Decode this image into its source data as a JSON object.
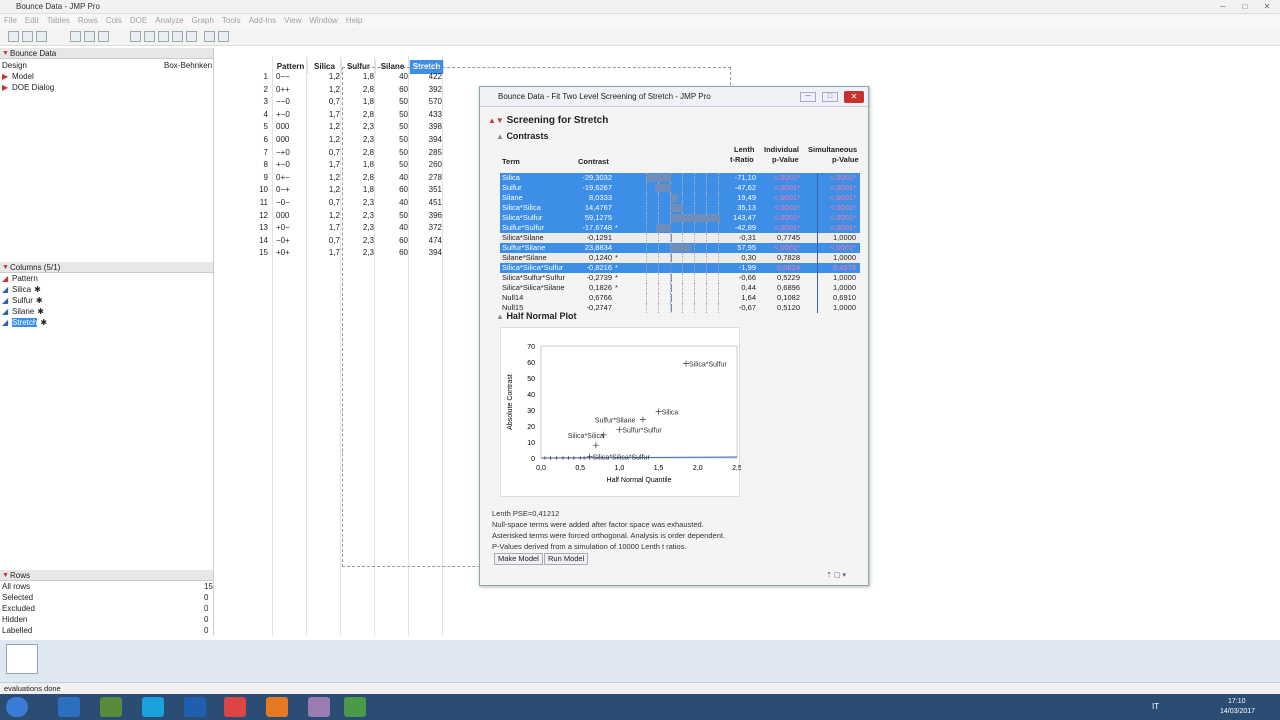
{
  "window": {
    "title": "Bounce Data - JMP Pro"
  },
  "menu": [
    "File",
    "Edit",
    "Tables",
    "Rows",
    "Cols",
    "DOE",
    "Analyze",
    "Graph",
    "Tools",
    "Add-Ins",
    "View",
    "Window",
    "Help"
  ],
  "left": {
    "table_name": "Bounce Data",
    "design_label": "Design",
    "design_value": "Box-Behnken",
    "items": [
      "Model",
      "DOE Dialog"
    ],
    "columns_header": "Columns (5/1)",
    "columns": [
      "Pattern",
      "Silica",
      "Sulfur",
      "Silane",
      "Stretch"
    ],
    "rows_header": "Rows",
    "rows": [
      {
        "label": "All rows",
        "value": "15"
      },
      {
        "label": "Selected",
        "value": "0"
      },
      {
        "label": "Excluded",
        "value": "0"
      },
      {
        "label": "Hidden",
        "value": "0"
      },
      {
        "label": "Labelled",
        "value": "0"
      }
    ]
  },
  "grid": {
    "headers": [
      "Pattern",
      "Silica",
      "Sulfur",
      "Silane",
      "Stretch"
    ],
    "rows": [
      [
        "1",
        "0−−",
        "1,2",
        "1,8",
        "40",
        "422"
      ],
      [
        "2",
        "0++",
        "1,2",
        "2,8",
        "60",
        "392"
      ],
      [
        "3",
        "−−0",
        "0,7",
        "1,8",
        "50",
        "570"
      ],
      [
        "4",
        "+−0",
        "1,7",
        "2,8",
        "50",
        "433"
      ],
      [
        "5",
        "000",
        "1,2",
        "2,3",
        "50",
        "398"
      ],
      [
        "6",
        "000",
        "1,2",
        "2,3",
        "50",
        "394"
      ],
      [
        "7",
        "−+0",
        "0,7",
        "2,8",
        "50",
        "285"
      ],
      [
        "8",
        "+−0",
        "1,7",
        "1,8",
        "50",
        "260"
      ],
      [
        "9",
        "0+−",
        "1,2",
        "2,8",
        "40",
        "278"
      ],
      [
        "10",
        "0−+",
        "1,2",
        "1,8",
        "60",
        "351"
      ],
      [
        "11",
        "−0−",
        "0,7",
        "2,3",
        "40",
        "451"
      ],
      [
        "12",
        "000",
        "1,2",
        "2,3",
        "50",
        "396"
      ],
      [
        "13",
        "+0−",
        "1,7",
        "2,3",
        "40",
        "372"
      ],
      [
        "14",
        "−0+",
        "0,7",
        "2,3",
        "60",
        "474"
      ],
      [
        "15",
        "+0+",
        "1,7",
        "2,3",
        "60",
        "394"
      ]
    ]
  },
  "report": {
    "title": "Bounce Data - Fit Two Level Screening of Stretch - JMP Pro",
    "outline": "Screening for Stretch",
    "contrasts_title": "Contrasts",
    "headers": {
      "term": "Term",
      "contrast": "Contrast",
      "lenth1": "Lenth",
      "lenth2": "t-Ratio",
      "ind1": "Individual",
      "ind2": "p-Value",
      "sim1": "Simultaneous",
      "sim2": "p-Value"
    },
    "terms": [
      {
        "term": "Silica",
        "contrast": "-29,3032",
        "lenth": "-71,10",
        "ind": "<,0001*",
        "sim": "<,0001*",
        "bar": -29.3,
        "sel": true,
        "star": ""
      },
      {
        "term": "Sulfur",
        "contrast": "-19,6267",
        "lenth": "-47,62",
        "ind": "<,0001*",
        "sim": "<,0001*",
        "bar": -19.6,
        "sel": true,
        "star": ""
      },
      {
        "term": "Silane",
        "contrast": "8,0333",
        "lenth": "19,49",
        "ind": "<,0001*",
        "sim": "<,0001*",
        "bar": 8.0,
        "sel": true,
        "star": ""
      },
      {
        "term": "Silica*Silica",
        "contrast": "14,4767",
        "lenth": "35,13",
        "ind": "<,0001*",
        "sim": "<,0001*",
        "bar": 14.5,
        "sel": true,
        "star": ""
      },
      {
        "term": "Silica*Sulfur",
        "contrast": "59,1275",
        "lenth": "143,47",
        "ind": "<,0001*",
        "sim": "<,0001*",
        "bar": 59.1,
        "sel": true,
        "star": ""
      },
      {
        "term": "Sulfur*Sulfur",
        "contrast": "-17,6748",
        "lenth": "-42,89",
        "ind": "<,0001*",
        "sim": "<,0001*",
        "bar": -17.7,
        "sel": true,
        "star": "*"
      },
      {
        "term": "Silica*Silane",
        "contrast": "-0,1291",
        "lenth": "-0,31",
        "ind": "0,7745",
        "sim": "1,0000",
        "bar": -0.13,
        "sel": false,
        "star": ""
      },
      {
        "term": "Sulfur*Silane",
        "contrast": "23,8834",
        "lenth": "57,95",
        "ind": "<,0001*",
        "sim": "<,0001*",
        "bar": 23.9,
        "sel": true,
        "star": ""
      },
      {
        "term": "Silane*Silane",
        "contrast": "0,1240",
        "lenth": "0,30",
        "ind": "0,7828",
        "sim": "1,0000",
        "bar": 0.12,
        "sel": false,
        "star": "*"
      },
      {
        "term": "Silica*Silica*Sulfur",
        "contrast": "-0,8216",
        "lenth": "-1,99",
        "ind": "0,0624",
        "sim": "0,4578",
        "bar": -0.82,
        "sel": true,
        "star": "*"
      },
      {
        "term": "Silica*Sulfur*Sulfur",
        "contrast": "-0,2739",
        "lenth": "-0,66",
        "ind": "0,5229",
        "sim": "1,0000",
        "bar": -0.27,
        "sel": false,
        "star": "*"
      },
      {
        "term": "Silica*Silica*Silane",
        "contrast": "0,1826",
        "lenth": "0,44",
        "ind": "0,6896",
        "sim": "1,0000",
        "bar": 0.18,
        "sel": false,
        "star": "*"
      },
      {
        "term": "Null14",
        "contrast": "0,6766",
        "lenth": "1,64",
        "ind": "0,1082",
        "sim": "0,6910",
        "bar": 0.68,
        "sel": false,
        "star": ""
      },
      {
        "term": "Null15",
        "contrast": "-0,2747",
        "lenth": "-0,67",
        "ind": "0,5120",
        "sim": "1,0000",
        "bar": -0.27,
        "sel": false,
        "star": ""
      }
    ],
    "half_normal_title": "Half Normal Plot",
    "half_normal": {
      "ylabel": "Absolute Contrast",
      "xlabel": "Half Normal Quantile",
      "yticks": [
        "70",
        "60",
        "50",
        "40",
        "30",
        "20",
        "10",
        "0"
      ],
      "xticks": [
        "0,0",
        "0,5",
        "1,0",
        "1,5",
        "2,0",
        "2,5"
      ],
      "points": [
        {
          "label": "Silica*Sulfur",
          "x": 1.85,
          "y": 59
        },
        {
          "label": "Silica",
          "x": 1.5,
          "y": 29
        },
        {
          "label": "Sulfur*Silane",
          "x": 1.3,
          "y": 24
        },
        {
          "label": "Sulfur*Sulfur",
          "x": 1.0,
          "y": 17.7
        },
        {
          "label": "Silica*Silica",
          "x": 0.8,
          "y": 14.5
        },
        {
          "label": "",
          "x": 0.7,
          "y": 8
        },
        {
          "label": "Silica*Silica*Sulfur",
          "x": 0.62,
          "y": 0.8
        }
      ]
    },
    "notes": [
      "Lenth PSE=0,41212",
      "Null-space terms were added after factor space was exhausted.",
      "Asterisked terms were forced orthogonal. Analysis is order dependent.",
      "P-Values derived from a simulation of 10000 Lenth t ratios."
    ],
    "buttons": {
      "make": "Make Model",
      "run": "Run Model"
    }
  },
  "status": "evaluations done",
  "tray": {
    "lang": "IT",
    "time": "17:10",
    "date": "14/03/2017"
  }
}
